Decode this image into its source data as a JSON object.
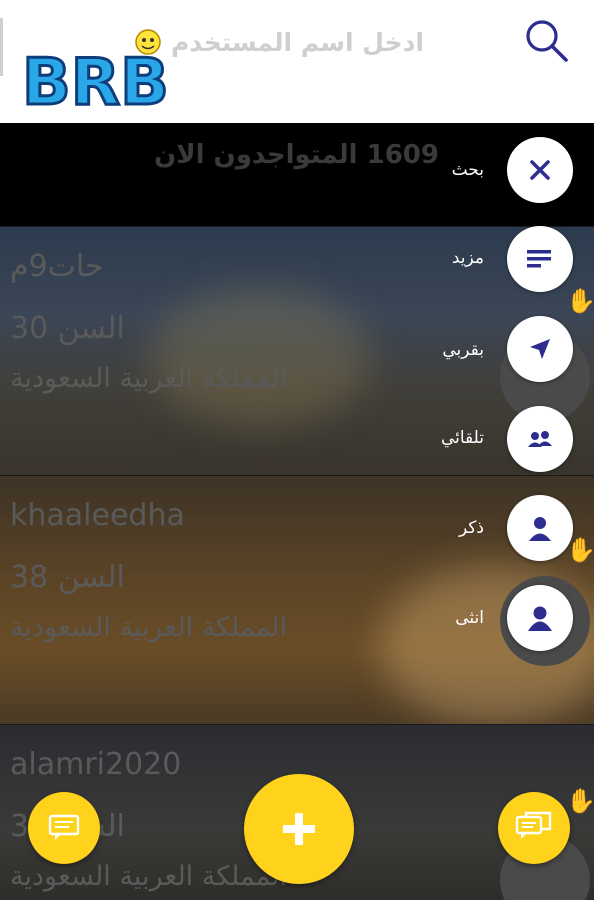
{
  "header": {
    "logo_text": "BRB",
    "search_placeholder": "ادخل اسم المستخدم"
  },
  "banner": {
    "online_text": "1609 المتواجدون الان"
  },
  "users": [
    {
      "username": "حات9م",
      "age": "30 السن",
      "country": "المملكة العربية السعودية"
    },
    {
      "username": "khaaleedha",
      "age": "38 السن",
      "country": "المملكة العربية السعودية"
    },
    {
      "username": "alamri2020",
      "age": "30 السن",
      "country": "المملكة العربية السعودية"
    }
  ],
  "fab_menu": [
    {
      "label": "بحث",
      "icon": "close-icon"
    },
    {
      "label": "مزيد",
      "icon": "more-lines-icon"
    },
    {
      "label": "بقربي",
      "icon": "navigation-arrow-icon"
    },
    {
      "label": "تلقائي",
      "icon": "group-icon"
    },
    {
      "label": "ذكر",
      "icon": "male-user-icon"
    },
    {
      "label": "انثى",
      "icon": "female-user-icon"
    }
  ],
  "colors": {
    "accent": "#ffd21c",
    "icon_blue": "#2d2c8f",
    "header_bg": "#ffffff"
  }
}
